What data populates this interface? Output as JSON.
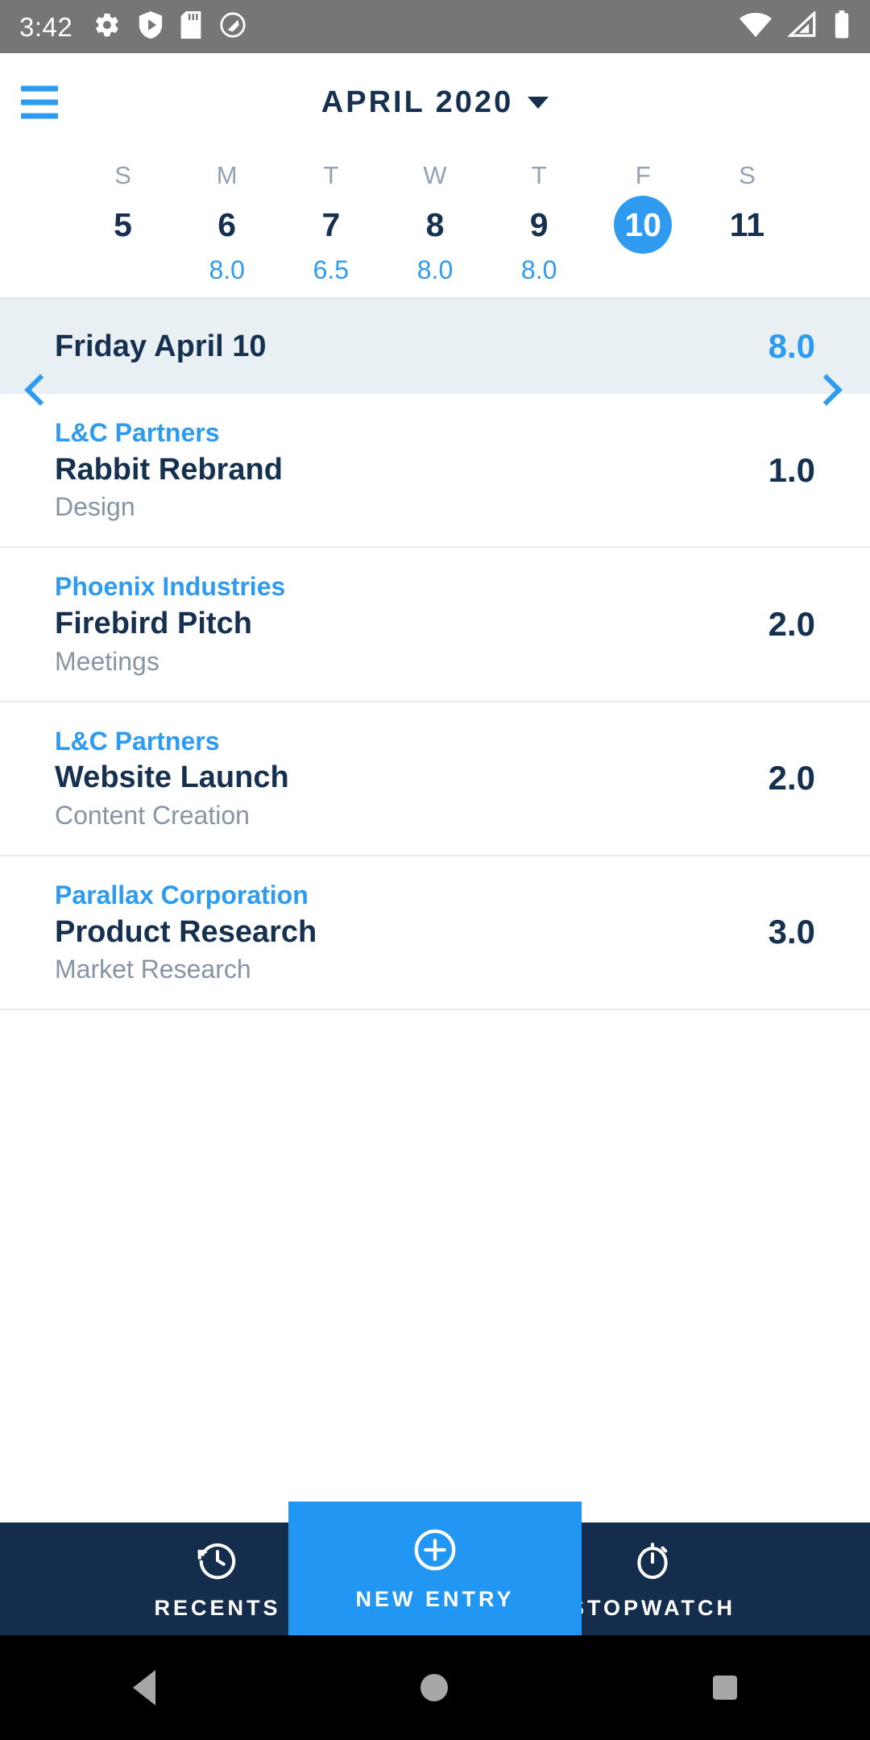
{
  "status_bar": {
    "time": "3:42",
    "left_icons": [
      "gear-icon",
      "play-protect-shield-icon",
      "sd-card-icon",
      "android-q-icon"
    ],
    "right_icons": [
      "wifi-icon",
      "cell-signal-icon",
      "battery-icon"
    ]
  },
  "header": {
    "menu_icon": "hamburger-menu-icon",
    "title": "APRIL 2020",
    "dropdown_icon": "caret-down-icon"
  },
  "week": {
    "prev_icon": "chevron-left-icon",
    "next_icon": "chevron-right-icon",
    "day_initials": [
      "S",
      "M",
      "T",
      "W",
      "T",
      "F",
      "S"
    ],
    "days": [
      {
        "date": "5",
        "hours": "",
        "selected": false
      },
      {
        "date": "6",
        "hours": "8.0",
        "selected": false
      },
      {
        "date": "7",
        "hours": "6.5",
        "selected": false
      },
      {
        "date": "8",
        "hours": "8.0",
        "selected": false
      },
      {
        "date": "9",
        "hours": "8.0",
        "selected": false
      },
      {
        "date": "10",
        "hours": "",
        "selected": true
      },
      {
        "date": "11",
        "hours": "",
        "selected": false
      }
    ]
  },
  "day_summary": {
    "label": "Friday April 10",
    "total": "8.0"
  },
  "entries": [
    {
      "client": "L&C Partners",
      "project": "Rabbit Rebrand",
      "task": "Design",
      "hours": "1.0"
    },
    {
      "client": "Phoenix Industries",
      "project": "Firebird Pitch",
      "task": "Meetings",
      "hours": "2.0"
    },
    {
      "client": "L&C Partners",
      "project": "Website Launch",
      "task": "Content Creation",
      "hours": "2.0"
    },
    {
      "client": "Parallax Corporation",
      "project": "Product Research",
      "task": "Market Research",
      "hours": "3.0"
    }
  ],
  "bottom_nav": {
    "recents": {
      "label": "RECENTS",
      "icon": "history-clock-icon"
    },
    "new_entry": {
      "label": "NEW ENTRY",
      "icon": "plus-circle-icon"
    },
    "stopwatch": {
      "label": "STOPWATCH",
      "icon": "stopwatch-icon"
    }
  },
  "system_nav": {
    "back": "back-triangle-icon",
    "home": "home-circle-icon",
    "recents": "recents-square-icon"
  },
  "colors": {
    "accent_blue": "#2E9BF0",
    "primary_blue": "#2196F3",
    "navy": "#16304F",
    "nav_bar_navy": "#142D4C",
    "summary_bg": "#E9F0F3",
    "muted_text": "#8794A4",
    "dow_text": "#92A2B3"
  }
}
